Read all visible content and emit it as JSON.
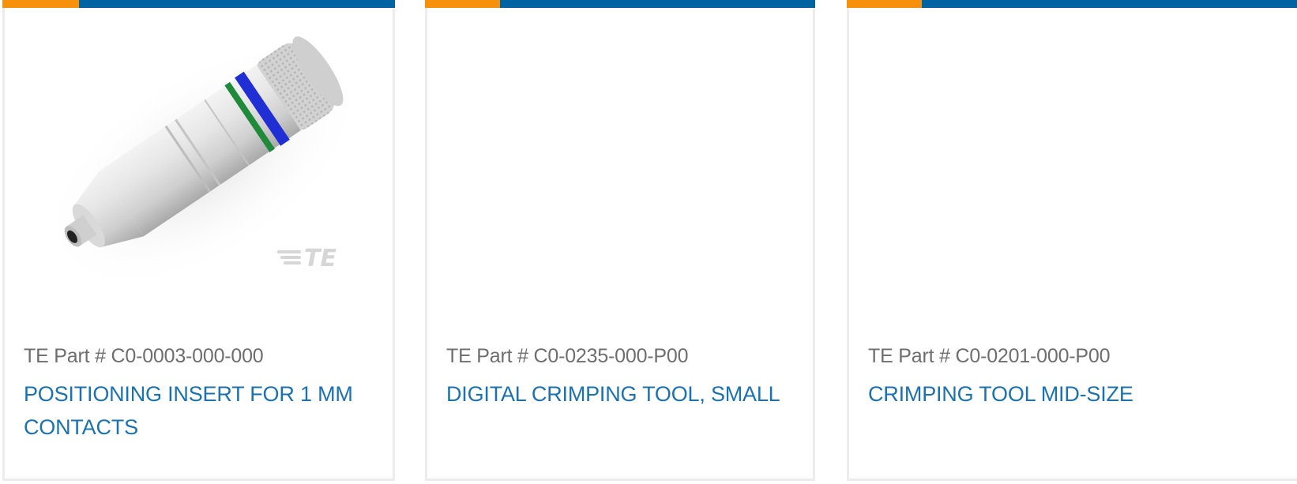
{
  "colors": {
    "accent_orange": "#f7910b",
    "bar_blue": "#0064a3",
    "link_blue": "#1a73b0",
    "part_gray": "#6e6e6e",
    "card_border": "#ececec"
  },
  "cards": [
    {
      "part_number": "TE Part # C0-0003-000-000",
      "title": "POSITIONING INSERT FOR 1 MM CONTACTS",
      "image": "positioning-insert-product-image",
      "image_logo": "TE"
    },
    {
      "part_number": "TE Part # C0-0235-000-P00",
      "title": "DIGITAL CRIMPING TOOL, SMALL",
      "image": "blank-product-image"
    },
    {
      "part_number": "TE Part # C0-0201-000-P00",
      "title": "CRIMPING TOOL MID-SIZE",
      "image": "blank-product-image"
    }
  ]
}
